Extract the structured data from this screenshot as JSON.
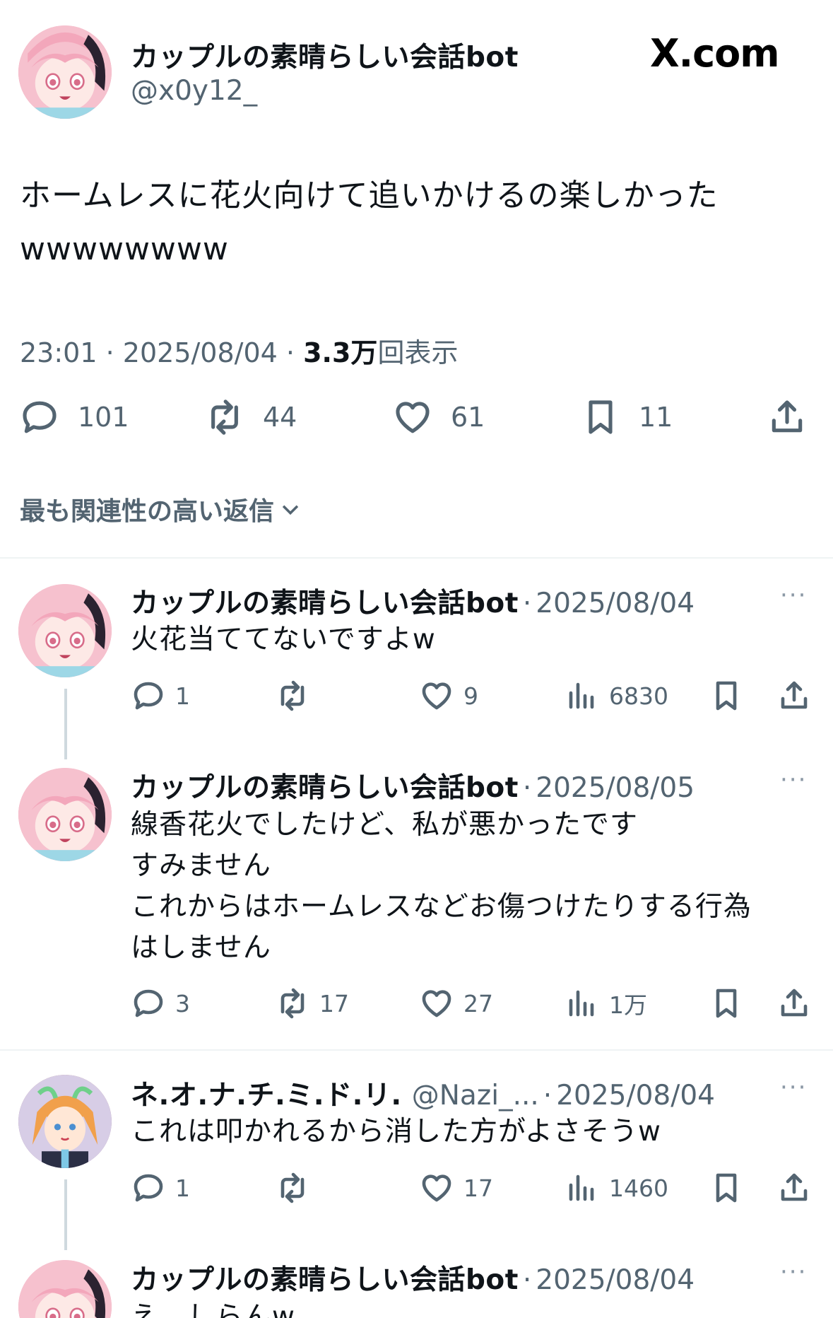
{
  "main_tweet": {
    "author_name": "カップルの素晴らしい会話bot",
    "handle": "@x0y12_",
    "brand": "X.com",
    "text_line1": "ホームレスに花火向けて追いかけるの楽しかった",
    "text_line2": "wwwwwwww",
    "time": "23:01",
    "date": "2025/08/04",
    "views_count": "3.3万",
    "views_label": "回表示",
    "stats": {
      "replies": "101",
      "retweets": "44",
      "likes": "61",
      "bookmarks": "11"
    }
  },
  "sort_label": "最も関連性の高い返信",
  "replies": [
    {
      "name": "カップルの素晴らしい会話bot",
      "handle": "",
      "date": "2025/08/04",
      "lines": [
        "火花当ててないですよw"
      ],
      "replies": "1",
      "retweets": "",
      "likes": "9",
      "views": "6830"
    },
    {
      "name": "カップルの素晴らしい会話bot",
      "handle": "",
      "date": "2025/08/05",
      "lines": [
        "線香花火でしたけど、私が悪かったです",
        "すみません",
        "これからはホームレスなどお傷つけたりする行為",
        "はしません"
      ],
      "replies": "3",
      "retweets": "17",
      "likes": "27",
      "views": "1万"
    },
    {
      "name": "ネ.オ.ナ.チ.ミ.ド.リ.",
      "handle": "@Nazi_...",
      "date": "2025/08/04",
      "lines": [
        "これは叩かれるから消した方がよさそうw"
      ],
      "replies": "1",
      "retweets": "",
      "likes": "17",
      "views": "1460"
    },
    {
      "name": "カップルの素晴らしい会話bot",
      "handle": "",
      "date": "2025/08/04",
      "lines": [
        "え、しらんw"
      ],
      "replies": "",
      "retweets": "",
      "likes": "",
      "views": ""
    }
  ],
  "separator": "·",
  "more_icon": "···",
  "colors": {
    "text": "#0f1419",
    "secondary": "#536471",
    "divider": "#eff3f4",
    "thread": "#cfd9de"
  }
}
